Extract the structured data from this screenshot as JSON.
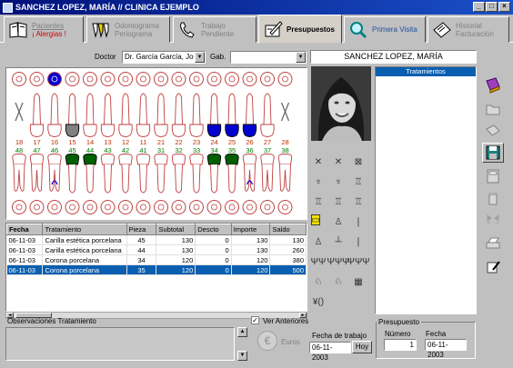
{
  "window": {
    "title": "SANCHEZ LOPEZ, MARÍA // CLINICA EJEMPLO",
    "minimize": "_",
    "maximize": "□",
    "close": "×"
  },
  "tabs": [
    {
      "line1": "Pacientes",
      "line2": "¡ Alergias !",
      "icon": "book-icon"
    },
    {
      "line1": "Odontograma",
      "line2": "Periograma",
      "icon": "teeth-icon"
    },
    {
      "line1": "Trabajo",
      "line2": "Pendiente",
      "icon": "phone-icon"
    },
    {
      "line1": "Presupuestos",
      "line2": "",
      "icon": "pen-paper-icon"
    },
    {
      "line1": "Primera Visita",
      "line2": "",
      "icon": "magnifier-icon"
    },
    {
      "line1": "Historial",
      "line2": "Facturación",
      "icon": "ledger-icon"
    }
  ],
  "filters": {
    "doctor_label": "Doctor",
    "doctor_value": "Dr. García García, Jo",
    "gab_label": "Gab.",
    "gab_value": "",
    "patient_name": "SANCHEZ LOPEZ, MARÍA"
  },
  "odontogram": {
    "upper_numbers": [
      "18",
      "17",
      "16",
      "15",
      "14",
      "13",
      "12",
      "11",
      "21",
      "22",
      "23",
      "24",
      "25",
      "26",
      "27",
      "28"
    ],
    "lower_numbers": [
      "48",
      "47",
      "46",
      "45",
      "44",
      "43",
      "42",
      "41",
      "31",
      "32",
      "33",
      "34",
      "35",
      "36",
      "37",
      "38"
    ]
  },
  "table": {
    "headers": [
      "Fecha",
      "Tratamiento",
      "Pieza",
      "Subtotal",
      "Descto",
      "Importe",
      "Saldo"
    ],
    "rows": [
      [
        "06-11-03",
        "Carilla estética porcelana",
        "45",
        "130",
        "0",
        "130",
        "130"
      ],
      [
        "06-11-03",
        "Carilla estética porcelana",
        "44",
        "130",
        "0",
        "130",
        "260"
      ],
      [
        "06-11-03",
        "Corona porcelana",
        "34",
        "120",
        "0",
        "120",
        "380"
      ],
      [
        "06-11-03",
        "Corona porcelana",
        "35",
        "120",
        "0",
        "120",
        "500"
      ]
    ],
    "selected_row": 3
  },
  "treatments_panel": {
    "title": "Tratamientos"
  },
  "observations": {
    "label": "Observaciones Tratamiento",
    "ver_anteriores": "Ver Anteriores"
  },
  "euros": {
    "label": "Euros"
  },
  "fecha_trabajo": {
    "label": "Fecha de trabajo",
    "value": "06-11-2003",
    "hoy": "Hoy"
  },
  "presupuesto": {
    "legend": "Presupuesto",
    "numero_label": "Número",
    "numero_value": "1",
    "fecha_label": "Fecha",
    "fecha_value": "06-11-2003"
  },
  "colors": {
    "title_bar": "#00107a",
    "selection": "#0a5fb0",
    "upper_number": "#c03000",
    "lower_number": "#008000",
    "blue_tooth": "#0000d0",
    "green_tooth": "#006000",
    "grey_tooth": "#808080"
  }
}
